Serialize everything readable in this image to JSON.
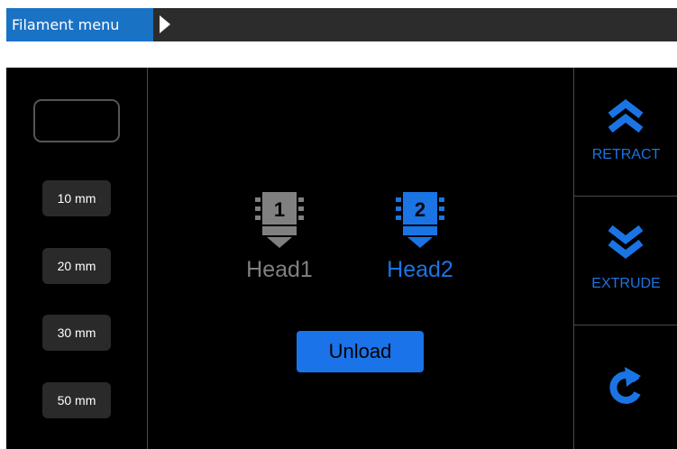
{
  "header": {
    "title": "Filament menu",
    "arrow_icon": "chevron-right-icon"
  },
  "left": {
    "amount_value": "",
    "steps": [
      "10 mm",
      "20 mm",
      "30 mm",
      "50 mm"
    ]
  },
  "heads": [
    {
      "label": "Head1",
      "number": "1",
      "color": "#808080",
      "selected": false
    },
    {
      "label": "Head2",
      "number": "2",
      "color": "#1b74e4",
      "selected": true
    }
  ],
  "unload_label": "Unload",
  "right": {
    "retract_label": "RETRACT",
    "retract_icon": "double-chevron-up-icon",
    "extrude_label": "EXTRUDE",
    "extrude_icon": "double-chevron-down-icon",
    "reset_icon": "refresh-icon"
  },
  "colors": {
    "accent": "#1a73e8",
    "title_bar": "#2c2c2c",
    "title_label_bg": "#1a72c5",
    "screen_bg": "#000000",
    "inactive": "#808080"
  }
}
